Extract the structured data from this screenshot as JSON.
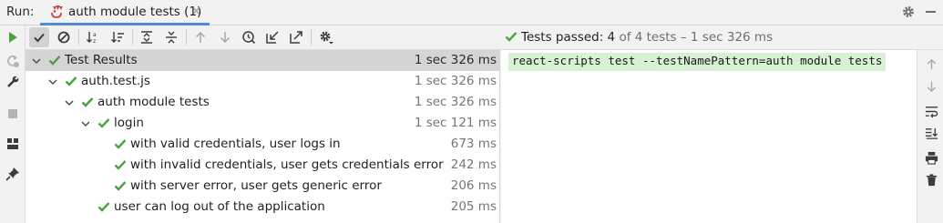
{
  "titlebar": {
    "run_label": "Run:",
    "tab_label": "auth module tests (1)",
    "tab_close": "×"
  },
  "status": {
    "prefix": "Tests passed:",
    "passed": "4",
    "of_total": "of 4 tests",
    "dash_duration": "– 1 sec 326 ms"
  },
  "toolbar": {
    "buttons": [
      "show-passed",
      "show-ignored",
      "sort-alphabetically",
      "sort-by-duration",
      "expand-all",
      "collapse-all",
      "previous-failed-test",
      "next-failed-test",
      "test-history",
      "import-tests",
      "export-test-results",
      "settings"
    ]
  },
  "tree": [
    {
      "label": "Test Results",
      "time": "1 sec 326 ms",
      "level": 0,
      "expanded": true,
      "selected": true
    },
    {
      "label": "auth.test.js",
      "time": "1 sec 326 ms",
      "level": 1,
      "expanded": true
    },
    {
      "label": "auth module tests",
      "time": "1 sec 326 ms",
      "level": 2,
      "expanded": true
    },
    {
      "label": "login",
      "time": "1 sec 121 ms",
      "level": 3,
      "expanded": true
    },
    {
      "label": "with valid credentials, user logs in",
      "time": "673 ms",
      "level": 4
    },
    {
      "label": "with invalid credentials, user gets credentials error",
      "time": "242 ms",
      "level": 4
    },
    {
      "label": "with server error, user gets generic error",
      "time": "206 ms",
      "level": 4
    },
    {
      "label": "user can log out of the application",
      "time": "205 ms",
      "level": 3
    }
  ],
  "console": {
    "command": "react-scripts test --testNamePattern=auth module tests"
  },
  "colors": {
    "pass_green": "#4aa33e",
    "selection": "#d5d5d5",
    "tab_underline": "#4f8ad7",
    "command_bg": "#d8f0d4"
  }
}
